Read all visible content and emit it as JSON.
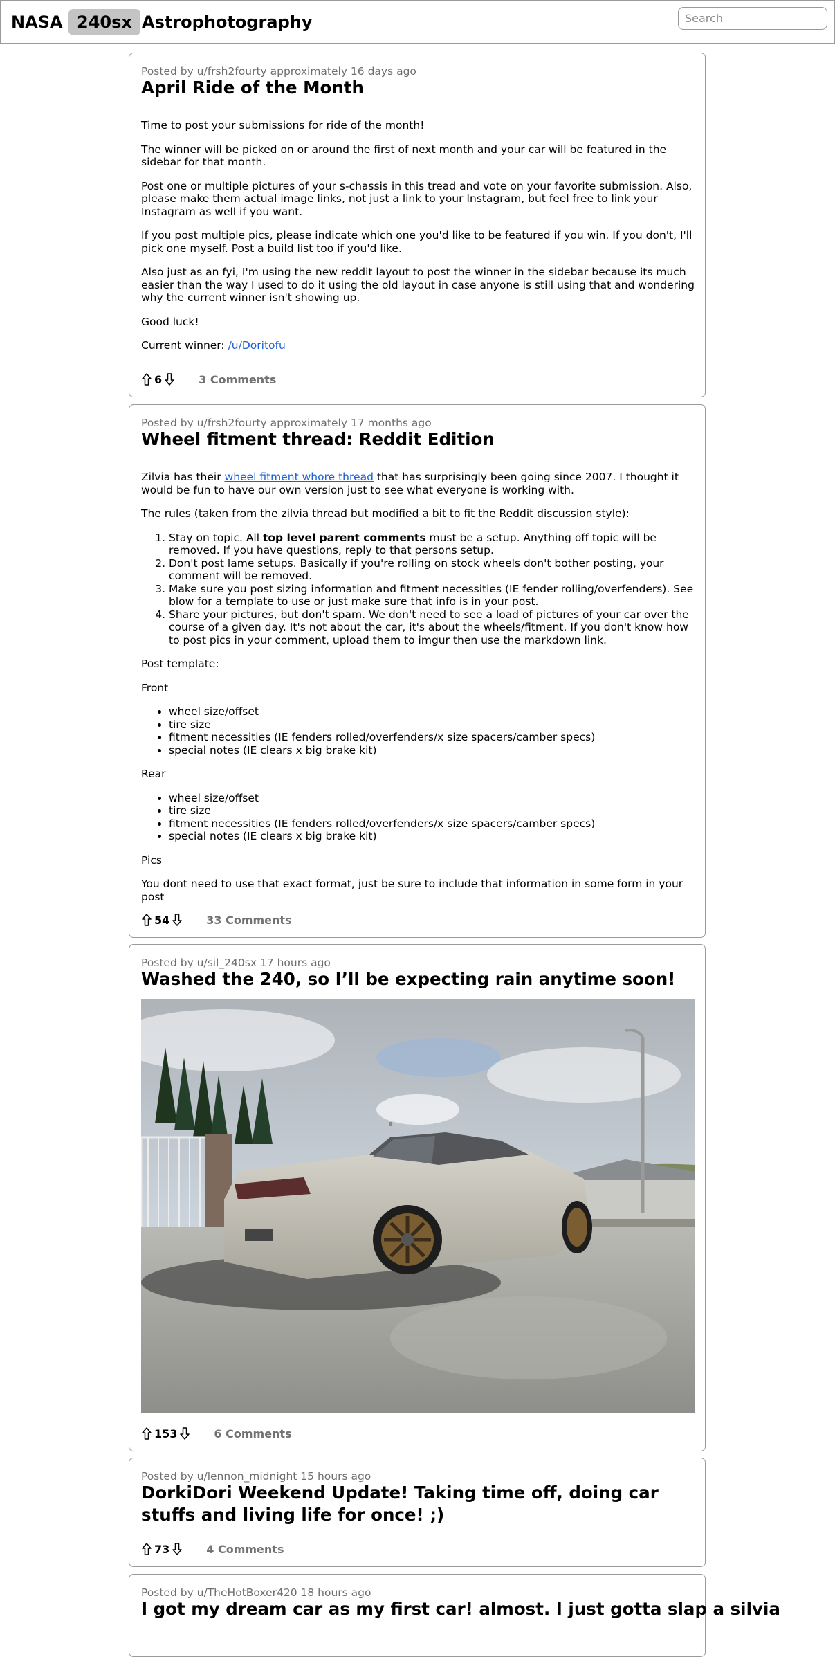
{
  "nav": {
    "tabs": [
      "NASA",
      "240sx",
      "Astrophotography"
    ],
    "active_tab": "240sx",
    "search_placeholder": "Search"
  },
  "posts": [
    {
      "meta": "Posted by u/frsh2fourty approximately 16 days ago",
      "title": "April Ride of the Month",
      "paragraphs": [
        "Time to post your submissions for ride of the month!",
        "The winner will be picked on or around the first of next month and your car will be featured in the sidebar for that month.",
        "Post one or multiple pictures of your s-chassis in this tread and vote on your favorite submission. Also, please make them actual image links, not just a link to your Instagram, but feel free to link your Instagram as well if you want.",
        "If you post multiple pics, please indicate which one you'd like to be featured if you win. If you don't, I'll pick one myself. Post a build list too if you'd like.",
        "Also just as an fyi, I'm using the new reddit layout to post the winner in the sidebar because its much easier than the way I used to do it using the old layout in case anyone is still using that and wondering why the current winner isn't showing up.",
        "Good luck!"
      ],
      "winner_label": "Current winner:",
      "winner_link": "/u/Doritofu",
      "score": "6",
      "comments": "3 Comments"
    },
    {
      "meta": "Posted by u/frsh2fourty approximately 17 months ago",
      "title": "Wheel fitment thread: Reddit Edition",
      "intro_before": "Zilvia has their ",
      "intro_link": "wheel fitment whore thread",
      "intro_after": " that has surprisingly been going since 2007. I thought it would be fun to have our own version just to see what everyone is working with.",
      "rules_intro": "The rules (taken from the zilvia thread but modified a bit to fit the Reddit discussion style):",
      "rule1_before": "Stay on topic. All ",
      "rule1_bold": "top level parent comments",
      "rule1_after": " must be a setup. Anything off topic will be removed. If you have questions, reply to that persons setup.",
      "rule2": "Don't post lame setups. Basically if you're rolling on stock wheels don't bother posting, your comment will be removed.",
      "rule3": "Make sure you post sizing information and fitment necessities (IE fender rolling/overfenders). See blow for a template to use or just make sure that info is in your post.",
      "rule4": "Share your pictures, but don't spam. We don't need to see a load of pictures of your car over the course of a given day. It's not about the car, it's about the wheels/fitment. If you don't know how to post pics in your comment, upload them to imgur then use the markdown link.",
      "template_label": "Post template:",
      "front_label": "Front",
      "front_items": [
        "wheel size/offset",
        "tire size",
        "fitment necessities (IE fenders rolled/overfenders/x size spacers/camber specs)",
        "special notes (IE clears x big brake kit)"
      ],
      "rear_label": "Rear",
      "rear_items": [
        "wheel size/offset",
        "tire size",
        "fitment necessities (IE fenders rolled/overfenders/x size spacers/camber specs)",
        "special notes (IE clears x big brake kit)"
      ],
      "pics_label": "Pics",
      "closing": "You dont need to use that exact format, just be sure to include that information in some form in your post",
      "score": "54",
      "comments": "33 Comments"
    },
    {
      "meta": "Posted by u/sil_240sx 17 hours ago",
      "title": "Washed the 240, so I’ll be expecting rain anytime soon!",
      "score": "153",
      "comments": "6 Comments"
    },
    {
      "meta": "Posted by u/lennon_midnight 15 hours ago",
      "title": "DorkiDori Weekend Update! Taking time off, doing car stuffs and living life for once! ;)",
      "score": "73",
      "comments": "4 Comments"
    },
    {
      "meta": "Posted by u/TheHotBoxer420 18 hours ago",
      "title": "I got my dream car as my first car! almost. I just gotta slap a silvia"
    }
  ],
  "colors": {
    "link": "#1a5fd6",
    "active_tab_bg": "#c4c4c4",
    "border": "#9a9a9a",
    "meta_text": "#6e6e6e"
  },
  "icons": [
    "upvote-arrow-icon",
    "downvote-arrow-icon"
  ]
}
